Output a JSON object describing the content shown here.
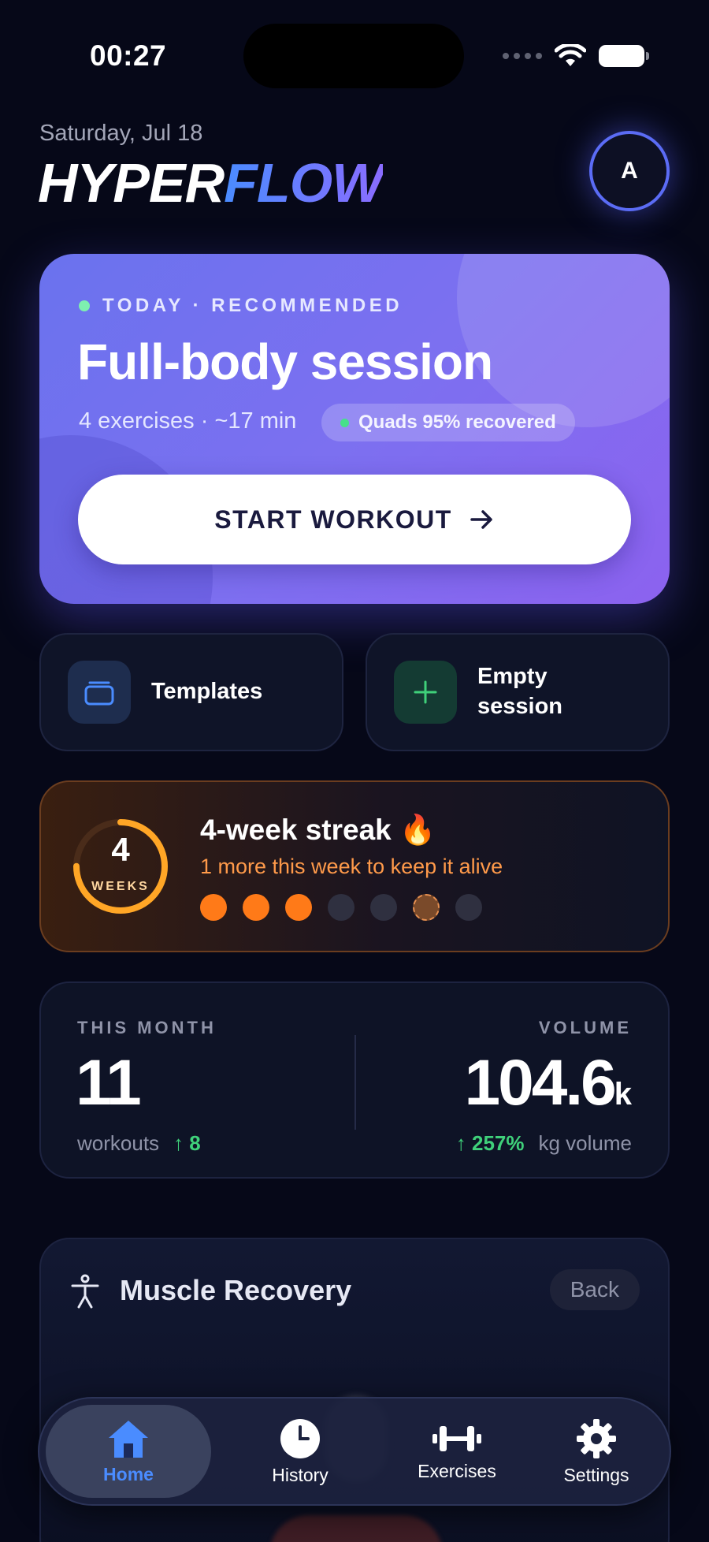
{
  "status": {
    "time": "00:27"
  },
  "header": {
    "date": "Saturday, Jul 18",
    "brand_part1": "HYPER",
    "brand_part2": "FLOW",
    "avatar_initial": "A"
  },
  "hero": {
    "tag": "TODAY · RECOMMENDED",
    "title": "Full-body session",
    "meta": "4 exercises · ~17 min",
    "pill": "Quads 95% recovered",
    "button": "START WORKOUT"
  },
  "actions": {
    "templates": "Templates",
    "empty_line1": "Empty",
    "empty_line2": "session"
  },
  "streak": {
    "ring_value": "4",
    "ring_label": "WEEKS",
    "ring_progress": 0.75,
    "title": "4-week streak 🔥",
    "subtitle": "1 more this week to keep it alive",
    "dots": [
      "on",
      "on",
      "on",
      "off",
      "off",
      "current",
      "off"
    ]
  },
  "month": {
    "left_label": "THIS MONTH",
    "workouts": "11",
    "workouts_label": "workouts",
    "workouts_delta": "↑ 8",
    "right_label": "VOLUME",
    "volume": "104.6",
    "volume_unit": "k",
    "volume_delta": "↑ 257%",
    "volume_label": "kg volume"
  },
  "recovery": {
    "title": "Muscle Recovery",
    "back": "Back"
  },
  "tabs": {
    "home": "Home",
    "history": "History",
    "exercises": "Exercises",
    "settings": "Settings"
  },
  "colors": {
    "accent": "#4a8cff",
    "hero": "#7c70f0",
    "streak": "#ff7a18",
    "positive": "#3fd07a"
  }
}
